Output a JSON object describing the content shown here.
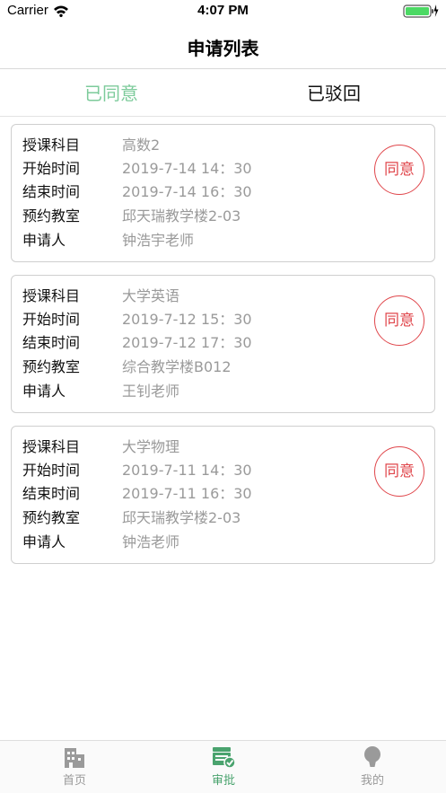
{
  "status": {
    "carrier": "Carrier",
    "time": "4:07 PM"
  },
  "nav": {
    "title": "申请列表"
  },
  "tabs": {
    "agreed": "已同意",
    "rejected": "已驳回"
  },
  "labels": {
    "subject": "授课科目",
    "start": "开始时间",
    "end": "结束时间",
    "room": "预约教室",
    "applicant": "申请人"
  },
  "cards": [
    {
      "subject": "高数2",
      "start": "2019-7-14 14：30",
      "end": "2019-7-14 16：30",
      "room": "邱天瑞教学楼2-03",
      "applicant": "钟浩宇老师",
      "stamp": "同意"
    },
    {
      "subject": "大学英语",
      "start": "2019-7-12 15：30",
      "end": "2019-7-12 17：30",
      "room": "综合教学楼B012",
      "applicant": "王钊老师",
      "stamp": "同意"
    },
    {
      "subject": "大学物理",
      "start": "2019-7-11 14：30",
      "end": "2019-7-11 16：30",
      "room": "邱天瑞教学楼2-03",
      "applicant": "钟浩老师",
      "stamp": "同意"
    }
  ],
  "tabbar": {
    "home": "首页",
    "approve": "审批",
    "mine": "我的"
  },
  "colors": {
    "accent": "#7dcb9b",
    "stamp": "#e0474c",
    "active_tab": "#4aa36e"
  }
}
